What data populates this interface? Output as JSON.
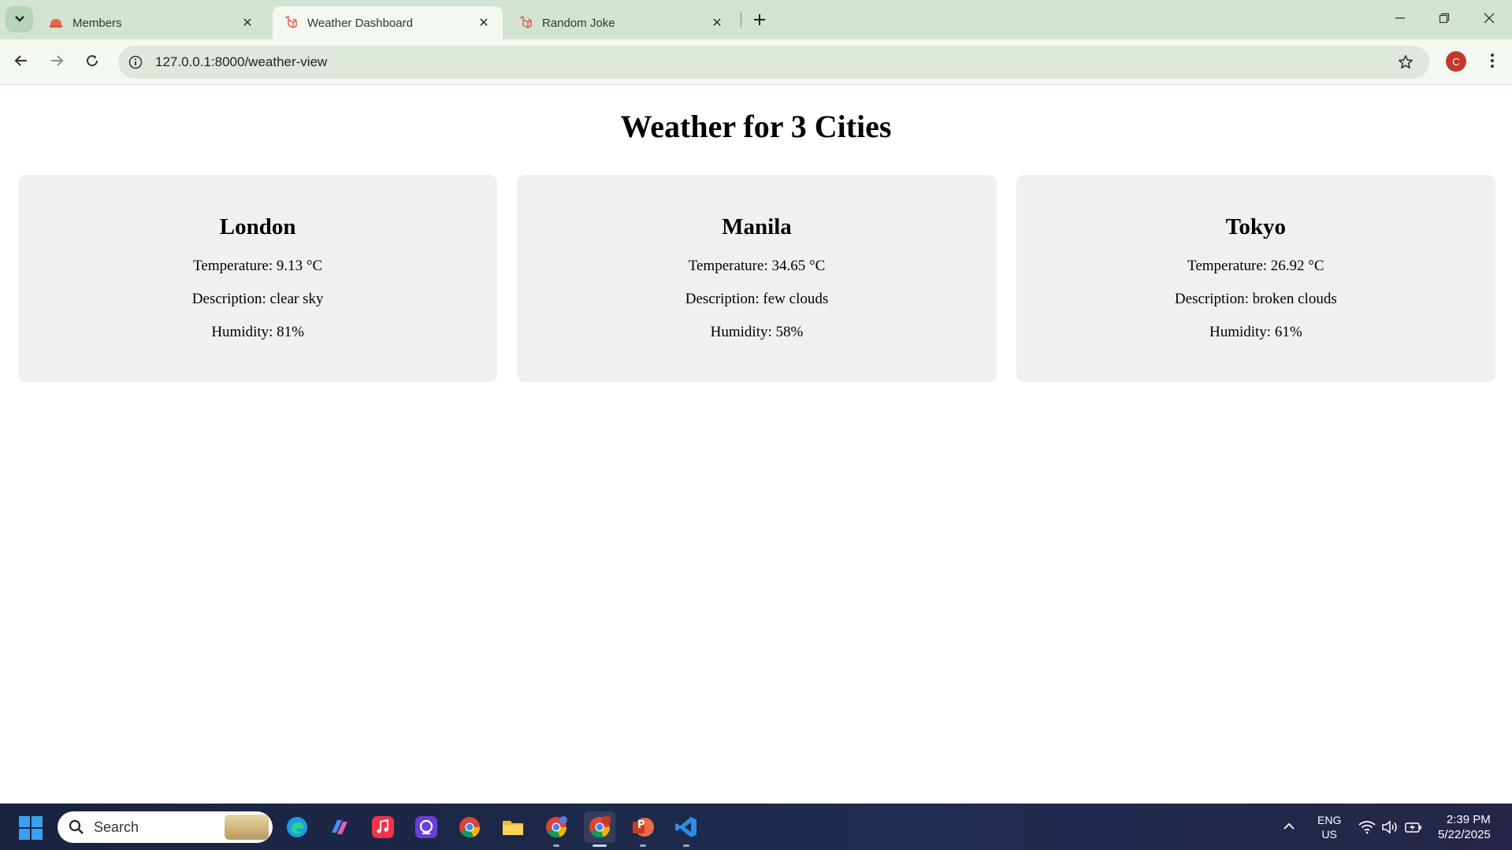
{
  "browser": {
    "tabs": [
      {
        "title": "Members",
        "active": false
      },
      {
        "title": "Weather Dashboard",
        "active": true
      },
      {
        "title": "Random Joke",
        "active": false
      }
    ],
    "profile_initial": "C",
    "url": "127.0.0.1:8000/weather-view"
  },
  "page": {
    "title": "Weather for 3 Cities",
    "cities": [
      {
        "name": "London",
        "temperature": "Temperature: 9.13 °C",
        "description": "Description: clear sky",
        "humidity": "Humidity: 81%"
      },
      {
        "name": "Manila",
        "temperature": "Temperature: 34.65 °C",
        "description": "Description: few clouds",
        "humidity": "Humidity: 58%"
      },
      {
        "name": "Tokyo",
        "temperature": "Temperature: 26.92 °C",
        "description": "Description: broken clouds",
        "humidity": "Humidity: 61%"
      }
    ]
  },
  "taskbar": {
    "search_label": "Search",
    "apps": [
      "edge",
      "copilot",
      "apple-music",
      "app",
      "chrome",
      "file-explorer",
      "chrome-alt",
      "chrome-profile",
      "powerpoint",
      "vscode"
    ],
    "powerpoint_letter": "P",
    "language_line1": "ENG",
    "language_line2": "US",
    "time": "2:39 PM",
    "date": "5/22/2025"
  },
  "colors": {
    "tabbar_bg": "#d3e3d3",
    "toolbar_bg": "#f3f8f1",
    "card_bg": "#f0f0f0",
    "taskbar_bg": "#1f2c4e",
    "profile": "#c0392b"
  }
}
